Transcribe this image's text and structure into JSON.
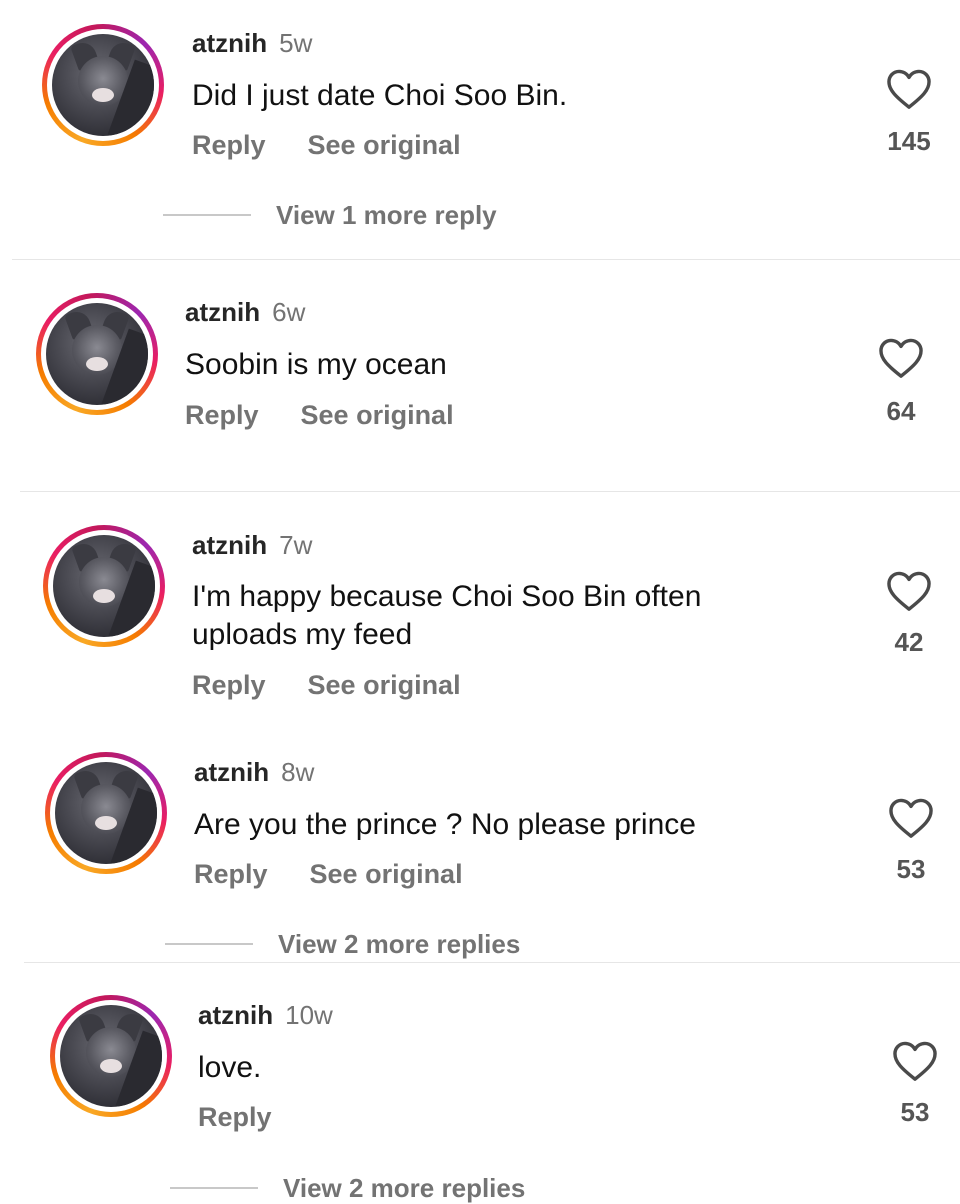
{
  "comments": [
    {
      "username": "atznih",
      "time": "5w",
      "text": "Did I just date Choi Soo Bin.",
      "reply_label": "Reply",
      "see_original_label": "See original",
      "likes": "145",
      "view_more": "View 1 more reply"
    },
    {
      "username": "atznih",
      "time": "6w",
      "text": "Soobin is my ocean",
      "reply_label": "Reply",
      "see_original_label": "See original",
      "likes": "64"
    },
    {
      "username": "atznih",
      "time": "7w",
      "text": "I'm happy because Choi Soo Bin often uploads my feed",
      "reply_label": "Reply",
      "see_original_label": "See original",
      "likes": "42"
    },
    {
      "username": "atznih",
      "time": "8w",
      "text": "Are you the prince ? No please prince",
      "reply_label": "Reply",
      "see_original_label": "See original",
      "likes": "53",
      "view_more": "View 2 more replies"
    },
    {
      "username": "atznih",
      "time": "10w",
      "text": "love.",
      "reply_label": "Reply",
      "likes": "53",
      "view_more": "View 2 more replies"
    }
  ],
  "icons": {
    "like": "heart-outline-icon",
    "avatar": "cat-photo-avatar"
  },
  "colors": {
    "ring_start": "#f9a825",
    "ring_mid": "#e91e63",
    "ring_end": "#9c27b0",
    "secondary_text": "#737373"
  }
}
